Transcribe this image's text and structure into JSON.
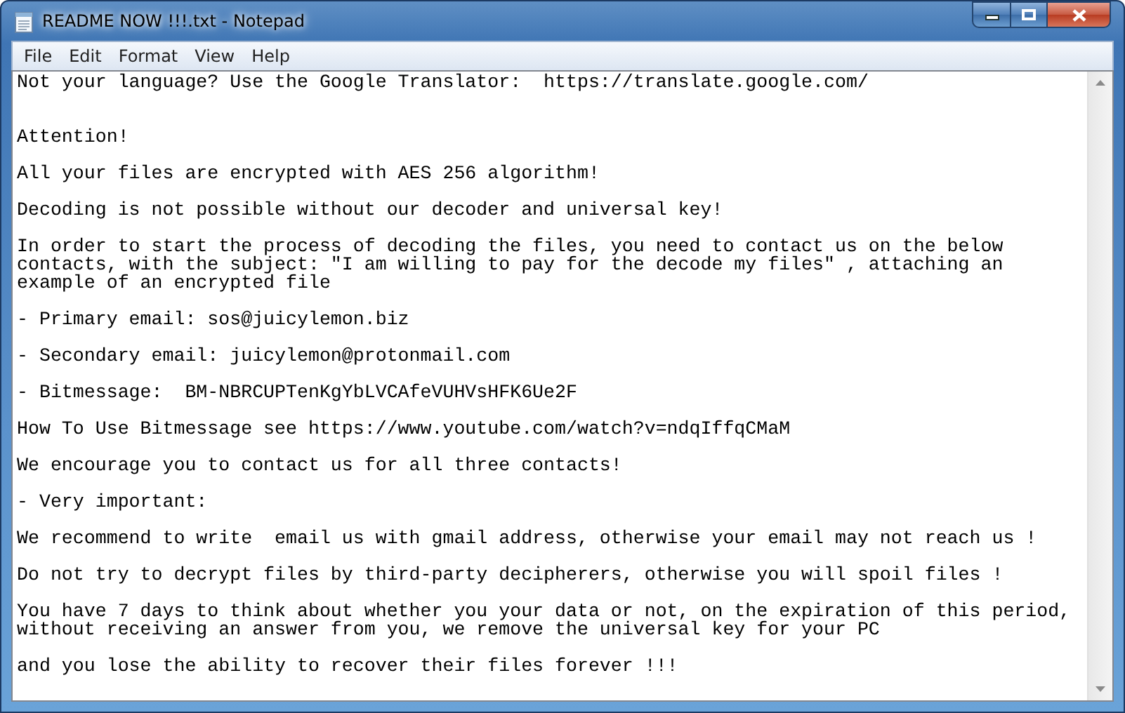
{
  "window": {
    "title": "README NOW !!!.txt - Notepad"
  },
  "menu": [
    "File",
    "Edit",
    "Format",
    "View",
    "Help"
  ],
  "paragraphs": [
    {
      "kind": "preface",
      "lines": [
        "Not your language? Use the Google Translator:  https://translate.google.com/"
      ]
    },
    {
      "kind": "body",
      "lines": [
        "Attention!"
      ]
    },
    {
      "kind": "body",
      "lines": [
        "All your files are encrypted with AES 256 algorithm!"
      ]
    },
    {
      "kind": "body",
      "lines": [
        "Decoding is not possible without our decoder and universal key!"
      ]
    },
    {
      "kind": "body",
      "lines": [
        "In order to start the process of decoding the files, you need to contact us on the below",
        "contacts, with the subject: \"I am willing to pay for the decode my files\" , attaching an",
        "example of an encrypted file"
      ]
    },
    {
      "kind": "body",
      "lines": [
        "- Primary email: sos@juicylemon.biz"
      ]
    },
    {
      "kind": "body",
      "lines": [
        "- Secondary email: juicylemon@protonmail.com"
      ]
    },
    {
      "kind": "body",
      "lines": [
        "- Bitmessage:  BM-NBRCUPTenKgYbLVCAfeVUHVsHFK6Ue2F"
      ]
    },
    {
      "kind": "body",
      "lines": [
        "How To Use Bitmessage see https://www.youtube.com/watch?v=ndqIffqCMaM"
      ]
    },
    {
      "kind": "body",
      "lines": [
        "We encourage you to contact us for all three contacts!"
      ]
    },
    {
      "kind": "body",
      "lines": [
        "- Very important:"
      ]
    },
    {
      "kind": "body",
      "lines": [
        "We recommend to write  email us with gmail address, otherwise your email may not reach us !"
      ]
    },
    {
      "kind": "body",
      "lines": [
        "Do not try to decrypt files by third-party decipherers, otherwise you will spoil files !"
      ]
    },
    {
      "kind": "body",
      "lines": [
        "You have 7 days to think about whether you your data or not, on the expiration of this period,",
        "without receiving an answer from you, we remove the universal key for your PC"
      ]
    },
    {
      "kind": "body",
      "lines": [
        "and you lose the ability to recover their files forever !!!"
      ]
    }
  ]
}
